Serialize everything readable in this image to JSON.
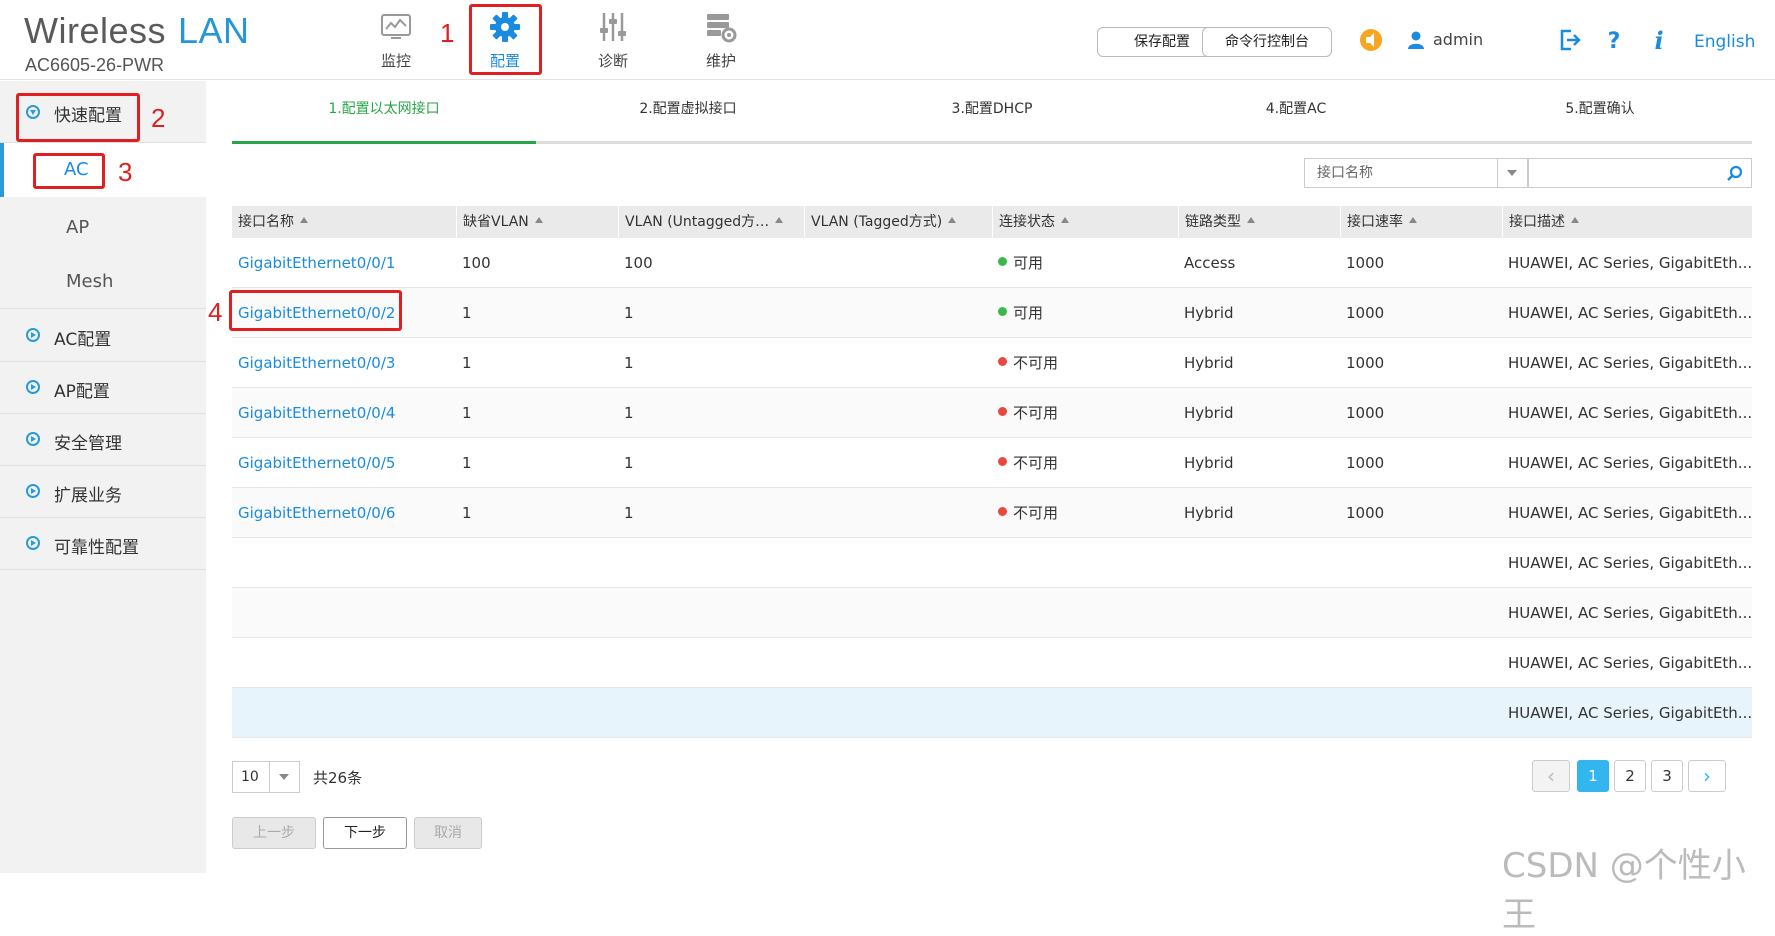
{
  "header": {
    "brand_word1": "Wireless",
    "brand_word2": "LAN",
    "device_model": "AC6605-26-PWR",
    "nav": [
      {
        "label": "监控",
        "icon": "monitor-icon"
      },
      {
        "label": "配置",
        "icon": "gear-icon",
        "active": true
      },
      {
        "label": "诊断",
        "icon": "sliders-icon"
      },
      {
        "label": "维护",
        "icon": "maintenance-icon"
      }
    ],
    "save_config_label": "保存配置",
    "cli_console_label": "命令行控制台",
    "user_name": "admin",
    "language_label": "English",
    "icons": [
      "alarm-speaker-icon",
      "user-icon",
      "logout-icon",
      "help-icon",
      "info-icon"
    ]
  },
  "annotations": {
    "n1": "1",
    "n2": "2",
    "n3": "3",
    "n4": "4"
  },
  "sidebar": {
    "quick_config": "快速配置",
    "sub_items": [
      "AC",
      "AP",
      "Mesh"
    ],
    "groups": [
      "AC配置",
      "AP配置",
      "安全管理",
      "扩展业务",
      "可靠性配置"
    ]
  },
  "steps": [
    "1.配置以太网接口",
    "2.配置虚拟接口",
    "3.配置DHCP",
    "4.配置AC",
    "5.配置确认"
  ],
  "search": {
    "field_label": "接口名称",
    "value": ""
  },
  "table": {
    "headers": [
      "接口名称",
      "缺省VLAN",
      "VLAN (Untagged方…",
      "VLAN (Tagged方式)",
      "连接状态",
      "链路类型",
      "接口速率",
      "接口描述"
    ],
    "rows": [
      {
        "name": "GigabitEthernet0/0/1",
        "pvid": "100",
        "untagged": "100",
        "tagged": "",
        "status": "可用",
        "status_color": "#3cb84a",
        "link": "Access",
        "speed": "1000",
        "desc": "HUAWEI, AC Series, GigabitEth..."
      },
      {
        "name": "GigabitEthernet0/0/2",
        "pvid": "1",
        "untagged": "1",
        "tagged": "",
        "status": "可用",
        "status_color": "#3cb84a",
        "link": "Hybrid",
        "speed": "1000",
        "desc": "HUAWEI, AC Series, GigabitEth..."
      },
      {
        "name": "GigabitEthernet0/0/3",
        "pvid": "1",
        "untagged": "1",
        "tagged": "",
        "status": "不可用",
        "status_color": "#e8483f",
        "link": "Hybrid",
        "speed": "1000",
        "desc": "HUAWEI, AC Series, GigabitEth..."
      },
      {
        "name": "GigabitEthernet0/0/4",
        "pvid": "1",
        "untagged": "1",
        "tagged": "",
        "status": "不可用",
        "status_color": "#e8483f",
        "link": "Hybrid",
        "speed": "1000",
        "desc": "HUAWEI, AC Series, GigabitEth..."
      },
      {
        "name": "GigabitEthernet0/0/5",
        "pvid": "1",
        "untagged": "1",
        "tagged": "",
        "status": "不可用",
        "status_color": "#e8483f",
        "link": "Hybrid",
        "speed": "1000",
        "desc": "HUAWEI, AC Series, GigabitEth..."
      },
      {
        "name": "GigabitEthernet0/0/6",
        "pvid": "1",
        "untagged": "1",
        "tagged": "",
        "status": "不可用",
        "status_color": "#e8483f",
        "link": "Hybrid",
        "speed": "1000",
        "desc": "HUAWEI, AC Series, GigabitEth..."
      },
      {
        "name": "",
        "pvid": "",
        "untagged": "",
        "tagged": "",
        "status": "",
        "status_color": "",
        "link": "",
        "speed": "",
        "desc": "HUAWEI, AC Series, GigabitEth..."
      },
      {
        "name": "",
        "pvid": "",
        "untagged": "",
        "tagged": "",
        "status": "",
        "status_color": "",
        "link": "",
        "speed": "",
        "desc": "HUAWEI, AC Series, GigabitEth..."
      },
      {
        "name": "",
        "pvid": "",
        "untagged": "",
        "tagged": "",
        "status": "",
        "status_color": "",
        "link": "",
        "speed": "",
        "desc": "HUAWEI, AC Series, GigabitEth..."
      },
      {
        "name": "",
        "pvid": "",
        "untagged": "",
        "tagged": "",
        "status": "",
        "status_color": "",
        "link": "",
        "speed": "",
        "desc": "HUAWEI, AC Series, GigabitEth...",
        "selected": true
      }
    ]
  },
  "pagination": {
    "page_size": "10",
    "total_label": "共26条",
    "pages": [
      "1",
      "2",
      "3"
    ],
    "current": "1"
  },
  "actions": {
    "prev_label": "上一步",
    "next_label": "下一步",
    "cancel_label": "取消"
  },
  "watermark": "CSDN @个性小王",
  "colors": {
    "accent": "#1a8be0",
    "step_active": "#2aa54a",
    "highlight": "#e02020"
  }
}
